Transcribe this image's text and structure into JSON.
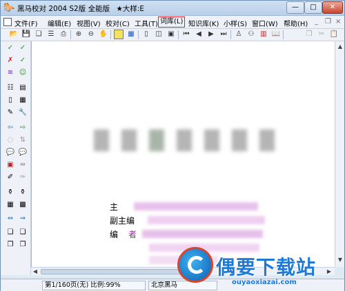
{
  "window": {
    "title": "黑马校对 2004  S2版  全能版",
    "doc_title": "★大样:E",
    "minimize": "—",
    "maximize": "□",
    "close": "✕"
  },
  "menu": {
    "items": [
      {
        "label": "文件(F)"
      },
      {
        "label": "编辑(E)"
      },
      {
        "label": "视图(V)"
      },
      {
        "label": "校对(C)"
      },
      {
        "label": "工具(T)"
      },
      {
        "label": "词库(L)"
      },
      {
        "label": "知识库(K)"
      },
      {
        "label": "小样(S)"
      },
      {
        "label": "窗口(W)"
      },
      {
        "label": "帮助(H)"
      }
    ],
    "highlighted": "词库(L)",
    "highlight_color": "#e02020"
  },
  "toolbar": {
    "icons": [
      "open-icon",
      "save-icon",
      "copy-icon",
      "list-icon",
      "print-icon",
      "zoom-in-icon",
      "zoom-out-icon",
      "hand-icon",
      "page-view-icon",
      "grid-icon",
      "page-single-icon",
      "page-double-icon",
      "page-multi-icon",
      "first-page-icon",
      "prev-page-icon",
      "play-icon",
      "next-page-icon",
      "last-page-icon",
      "person-icon",
      "binoculars-icon",
      "chart-icon",
      "book-icon",
      "cut-icon",
      "paste-icon"
    ]
  },
  "document": {
    "credits": [
      {
        "role": "主"
      },
      {
        "role": "副主编"
      },
      {
        "role": "编",
        "role2": "者"
      }
    ]
  },
  "status": {
    "page_info": "第1/160页(无) 比例:99%",
    "company": "北京黑马"
  },
  "watermark": {
    "text": "偶要下载站",
    "url": "ouyaoxiazai.com"
  }
}
